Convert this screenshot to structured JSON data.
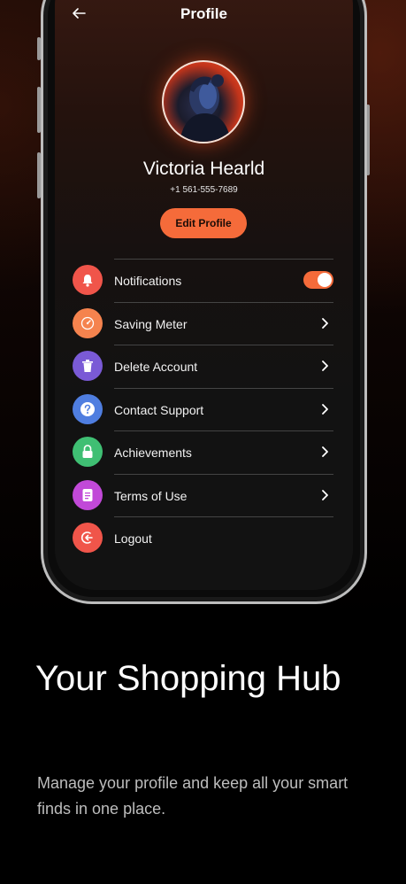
{
  "header": {
    "back_icon": "arrow-left-icon",
    "title": "Profile"
  },
  "profile": {
    "name": "Victoria Hearld",
    "phone": "+1 561-555-7689",
    "edit_label": "Edit Profile"
  },
  "menu": [
    {
      "label": "Notifications",
      "icon": "bell-icon",
      "color": "#f0554a",
      "trailing": "toggle",
      "toggle_on": true
    },
    {
      "label": "Saving Meter",
      "icon": "gauge-icon",
      "color": "#f5834e",
      "trailing": "chevron"
    },
    {
      "label": "Delete Account",
      "icon": "trash-icon",
      "color": "#7a5ad6",
      "trailing": "chevron"
    },
    {
      "label": "Contact Support",
      "icon": "question-icon",
      "color": "#4f7ee0",
      "trailing": "chevron"
    },
    {
      "label": "Achievements",
      "icon": "lock-icon",
      "color": "#3fbf73",
      "trailing": "chevron"
    },
    {
      "label": "Terms of Use",
      "icon": "document-icon",
      "color": "#c149d8",
      "trailing": "chevron"
    },
    {
      "label": "Logout",
      "icon": "logout-icon",
      "color": "#f0554a",
      "trailing": "none"
    }
  ],
  "promo": {
    "headline": "Your Shopping Hub",
    "body": "Manage your profile and keep all your smart finds in one place."
  },
  "colors": {
    "accent": "#f56b3a",
    "toggle_knob": "#ffffff"
  }
}
